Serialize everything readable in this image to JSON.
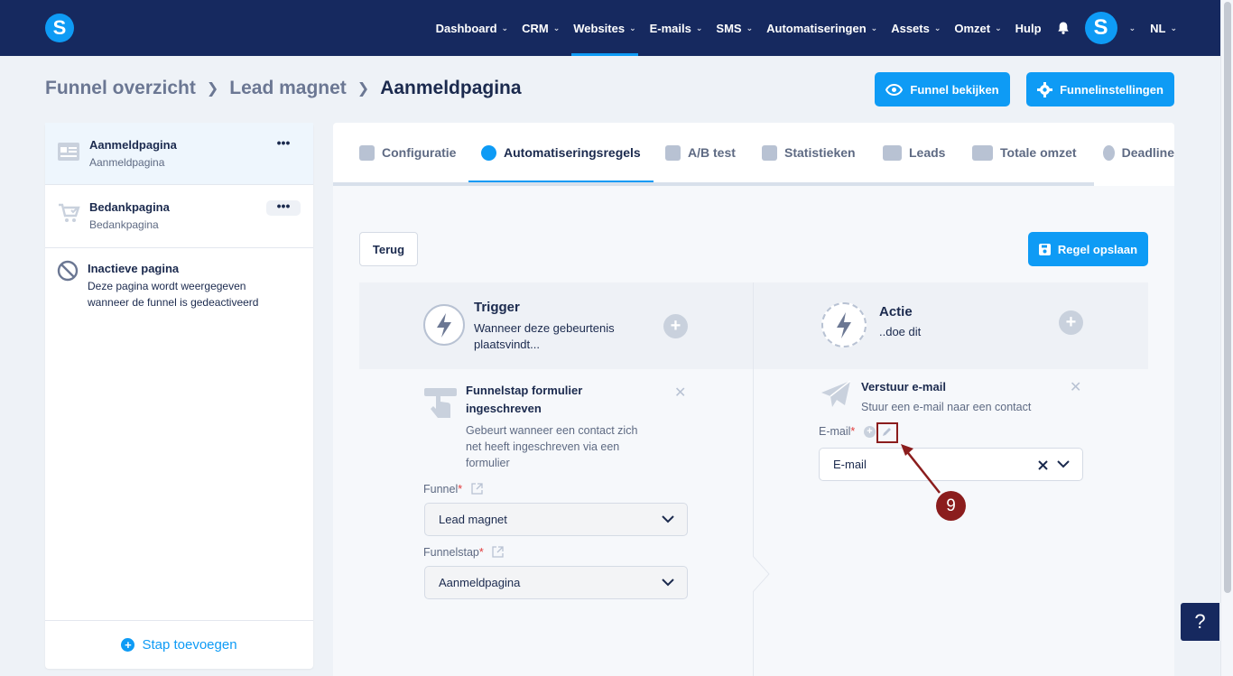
{
  "nav": {
    "items": [
      {
        "label": "Dashboard",
        "chevron": true,
        "active": false
      },
      {
        "label": "CRM",
        "chevron": true,
        "active": false
      },
      {
        "label": "Websites",
        "chevron": true,
        "active": true
      },
      {
        "label": "E-mails",
        "chevron": true,
        "active": false
      },
      {
        "label": "SMS",
        "chevron": true,
        "active": false
      },
      {
        "label": "Automatiseringen",
        "chevron": true,
        "active": false
      },
      {
        "label": "Assets",
        "chevron": true,
        "active": false
      },
      {
        "label": "Omzet",
        "chevron": true,
        "active": false
      },
      {
        "label": "Hulp",
        "chevron": false,
        "active": false
      }
    ],
    "logo_letter": "S",
    "avatar_letter": "S",
    "language": "NL"
  },
  "breadcrumb": {
    "items": [
      "Funnel overzicht",
      "Lead magnet",
      "Aanmeldpagina"
    ]
  },
  "header_buttons": {
    "view_funnel": "Funnel bekijken",
    "funnel_settings": "Funnelinstellingen"
  },
  "sidebar": {
    "steps": [
      {
        "title": "Aanmeldpagina",
        "subtitle": "Aanmeldpagina"
      },
      {
        "title": "Bedankpagina",
        "subtitle": "Bedankpagina"
      }
    ],
    "inactive": {
      "title": "Inactieve pagina",
      "description_line1": "Deze pagina wordt weergegeven",
      "description_line2": "wanneer de funnel is gedeactiveerd"
    },
    "add_step": "Stap toevoegen",
    "menu_dots": "•••"
  },
  "tabs": [
    {
      "label": "Configuratie",
      "active": false
    },
    {
      "label": "Automatiseringsregels",
      "active": true
    },
    {
      "label": "A/B test",
      "active": false
    },
    {
      "label": "Statistieken",
      "active": false
    },
    {
      "label": "Leads",
      "active": false
    },
    {
      "label": "Totale omzet",
      "active": false
    },
    {
      "label": "Deadline",
      "active": false
    }
  ],
  "actions": {
    "back": "Terug",
    "save_rule": "Regel opslaan"
  },
  "trigger": {
    "title": "Trigger",
    "subtitle_line1": "Wanneer deze gebeurtenis",
    "subtitle_line2": "plaatsvindt...",
    "card_title_line1": "Funnelstap formulier",
    "card_title_line2": "ingeschreven",
    "card_desc_line1": "Gebeurt wanneer een contact zich",
    "card_desc_line2": "net heeft ingeschreven via een",
    "card_desc_line3": "formulier",
    "funnel_label": "Funnel",
    "funnel_value": "Lead magnet",
    "funnelstap_label": "Funnelstap",
    "funnelstap_value": "Aanmeldpagina"
  },
  "action": {
    "title": "Actie",
    "subtitle": "..doe dit",
    "card_title": "Verstuur e-mail",
    "card_desc": "Stuur een e-mail naar een contact",
    "email_label": "E-mail",
    "email_value": "E-mail"
  },
  "annotation": {
    "number": "9"
  },
  "help": "?",
  "colors": {
    "navy": "#16295f",
    "accent": "#0e9bf5",
    "annotation": "#8b1d1d"
  }
}
